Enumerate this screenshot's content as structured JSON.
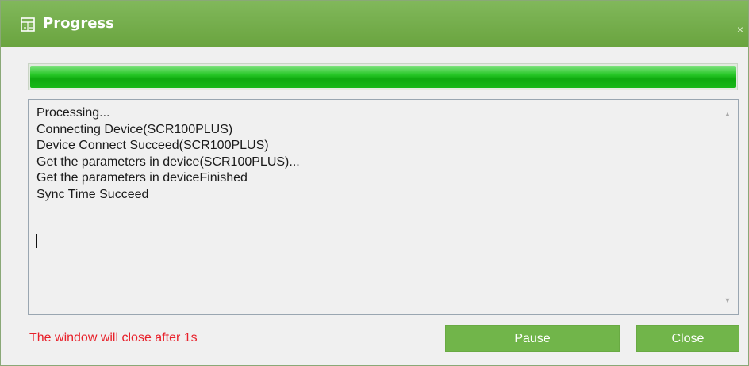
{
  "window": {
    "title": "Progress",
    "close_glyph": "×",
    "icon": "progress-window-icon"
  },
  "progress": {
    "percent": 100,
    "color": "#18b818"
  },
  "log": {
    "lines": [
      "Processing...",
      "Connecting Device(SCR100PLUS)",
      "Device Connect Succeed(SCR100PLUS)",
      "Get the parameters in device(SCR100PLUS)...",
      "Get the parameters in deviceFinished",
      "Sync Time Succeed"
    ],
    "scroll_up_glyph": "▲",
    "scroll_down_glyph": "▼"
  },
  "status": {
    "text": "The window will close after 1s",
    "color": "#e8202a"
  },
  "buttons": {
    "pause_label": "Pause",
    "close_label": "Close",
    "color": "#71b54a"
  }
}
